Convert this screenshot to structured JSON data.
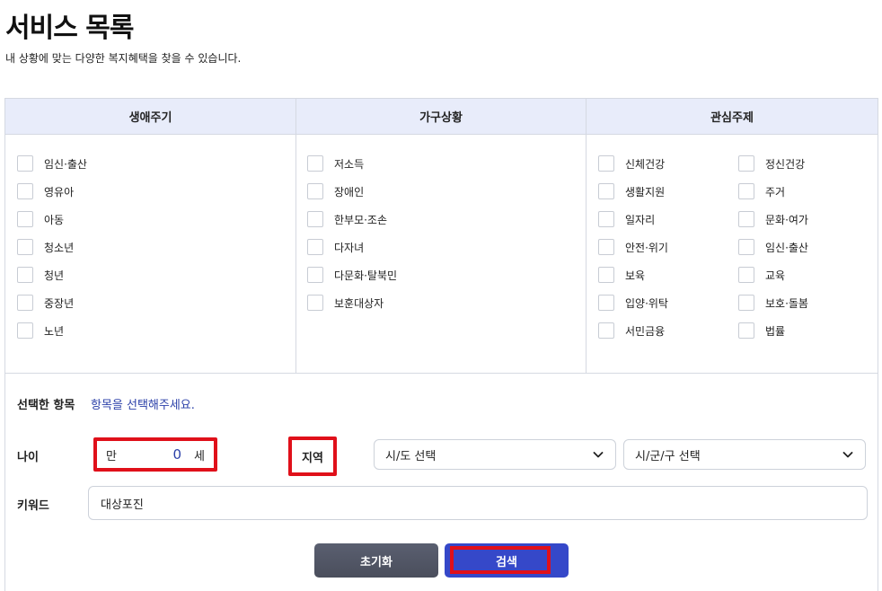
{
  "page": {
    "title": "서비스 목록",
    "description": "내 상황에 맞는 다양한 복지혜택을 찾을 수 있습니다."
  },
  "columns": {
    "life_cycle": {
      "header": "생애주기",
      "items": [
        "임신·출산",
        "영유아",
        "아동",
        "청소년",
        "청년",
        "중장년",
        "노년"
      ]
    },
    "household": {
      "header": "가구상황",
      "items": [
        "저소득",
        "장애인",
        "한부모·조손",
        "다자녀",
        "다문화·탈북민",
        "보훈대상자"
      ]
    },
    "interest": {
      "header": "관심주제",
      "left_items": [
        "신체건강",
        "생활지원",
        "일자리",
        "안전·위기",
        "보육",
        "입양·위탁",
        "서민금융"
      ],
      "right_items": [
        "정신건강",
        "주거",
        "문화·여가",
        "임신·출산",
        "교육",
        "보호·돌봄",
        "법률"
      ]
    }
  },
  "selected": {
    "label": "선택한 항목",
    "value": "항목을 선택해주세요."
  },
  "age": {
    "label": "나이",
    "prefix": "만",
    "value": "0",
    "suffix": "세"
  },
  "region": {
    "label": "지역",
    "sido_placeholder": "시/도 선택",
    "sigungu_placeholder": "시/군/구 선택"
  },
  "keyword": {
    "label": "키워드",
    "value": "대상포진"
  },
  "buttons": {
    "reset": "초기화",
    "search": "검색"
  },
  "colors": {
    "header_bg": "#e8ecfa",
    "accent": "#3548c9",
    "highlight": "#e0101a",
    "reset_bg": "#4a4e5c"
  }
}
